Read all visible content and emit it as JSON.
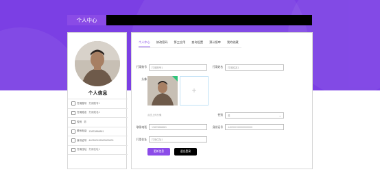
{
  "header": {
    "title": "个人中心"
  },
  "profile": {
    "panel_title": "个人信息",
    "rows": [
      {
        "icon": "user-icon",
        "label": "打用账号",
        "value": "打用账号1"
      },
      {
        "icon": "id-icon",
        "label": "打用姓名",
        "value": "打用姓名1"
      },
      {
        "icon": "gender-icon",
        "label": "性别",
        "value": "男"
      },
      {
        "icon": "phone-icon",
        "label": "联系电话",
        "value": "13823888881"
      },
      {
        "icon": "card-icon",
        "label": "身份证号",
        "value": "440300199000000000"
      },
      {
        "icon": "location-icon",
        "label": "打用住址",
        "value": "打用住址1"
      }
    ]
  },
  "tabs": [
    "个人中心",
    "修改密码",
    "第三应用",
    "查询设置",
    "预计报审",
    "我的收藏"
  ],
  "form": {
    "account_label": "打用账号",
    "account_value": "打用账号1",
    "name_label": "打用姓名",
    "name_value": "打用姓名1",
    "avatar_label": "头像",
    "upload_hint": "点击上传头像",
    "gender_label": "性别",
    "gender_value": "男",
    "phone_label": "联系电话",
    "phone_value": "13823888881",
    "idcard_label": "身份证号",
    "idcard_value": "440300199000000000",
    "address_label": "打用住址",
    "address_value": "打用住址1"
  },
  "buttons": {
    "save": "更新信息",
    "logout": "退出登录"
  },
  "colors": {
    "accent": "#7b3fe4",
    "save_button": "#8b4be8",
    "logout_button": "#000000"
  }
}
